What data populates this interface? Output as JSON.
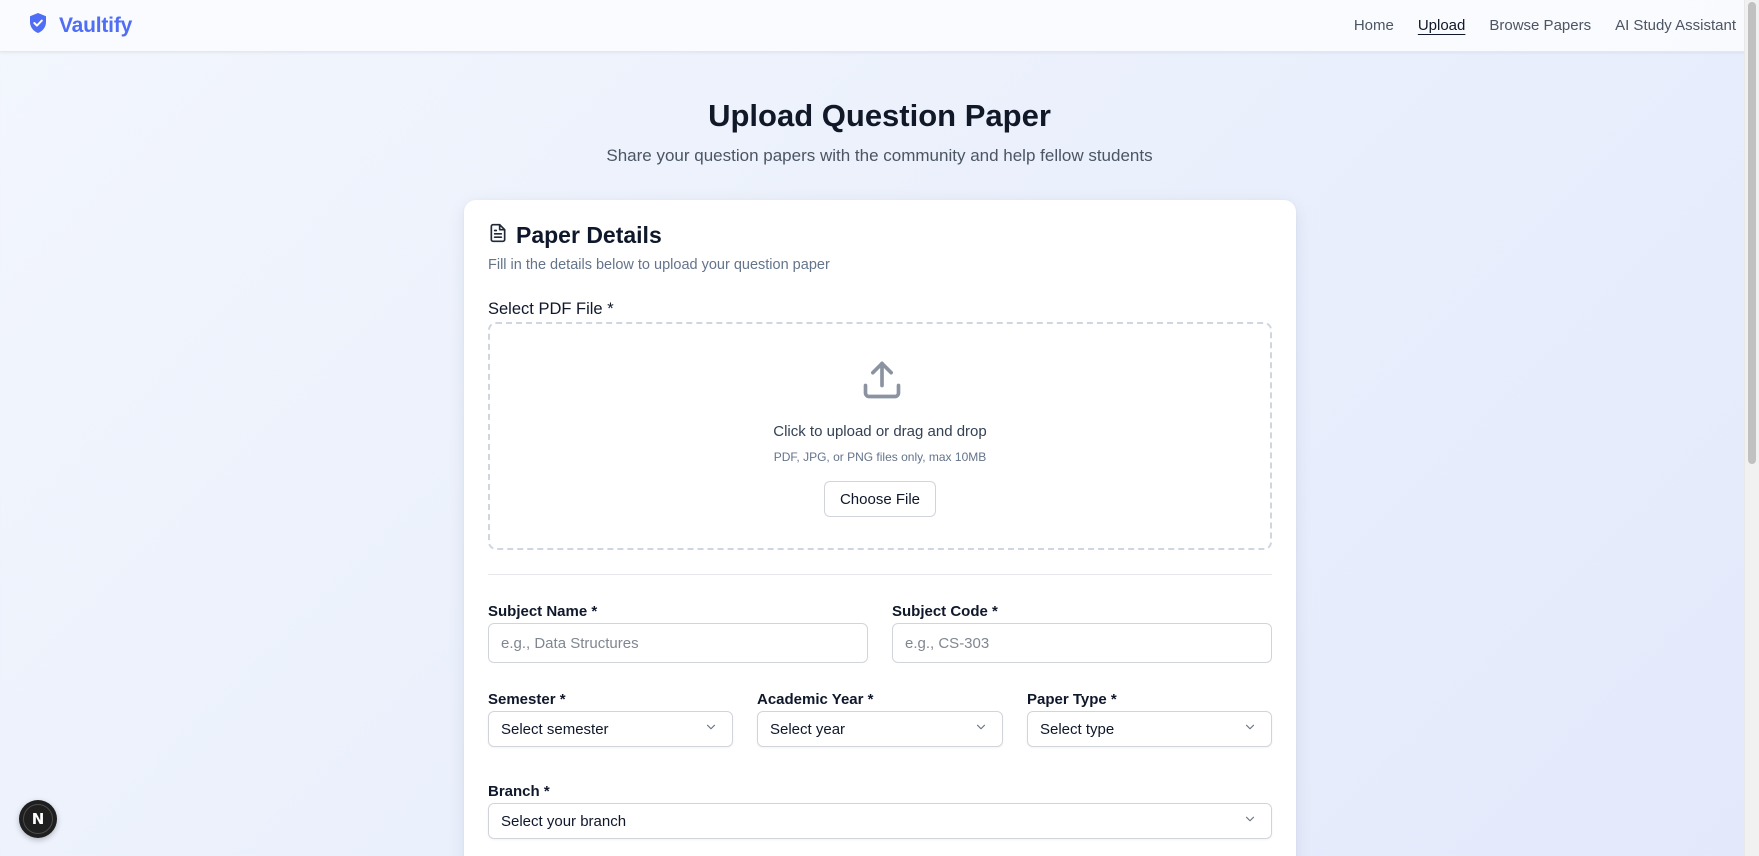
{
  "nav": {
    "brand": "Vaultify",
    "links": [
      {
        "label": "Home",
        "active": false
      },
      {
        "label": "Upload",
        "active": true
      },
      {
        "label": "Browse Papers",
        "active": false
      },
      {
        "label": "AI Study Assistant",
        "active": false
      }
    ]
  },
  "page": {
    "title": "Upload Question Paper",
    "subtitle": "Share your question papers with the community and help fellow students"
  },
  "card": {
    "title": "Paper Details",
    "description": "Fill in the details below to upload your question paper",
    "file": {
      "label": "Select PDF File *",
      "prompt": "Click to upload or drag and drop",
      "hint": "PDF, JPG, or PNG files only, max 10MB",
      "button": "Choose File"
    },
    "subject_name": {
      "label": "Subject Name *",
      "placeholder": "e.g., Data Structures"
    },
    "subject_code": {
      "label": "Subject Code *",
      "placeholder": "e.g., CS-303"
    },
    "semester": {
      "label": "Semester *",
      "value": "Select semester"
    },
    "academic_year": {
      "label": "Academic Year *",
      "value": "Select year"
    },
    "paper_type": {
      "label": "Paper Type *",
      "value": "Select type"
    },
    "branch": {
      "label": "Branch *",
      "value": "Select your branch"
    }
  },
  "dev_badge": {
    "glyph": "N"
  },
  "colors": {
    "brand": "#4f6df5",
    "text": "#0f172a",
    "muted": "#4b5563",
    "border": "#d1d5db"
  }
}
